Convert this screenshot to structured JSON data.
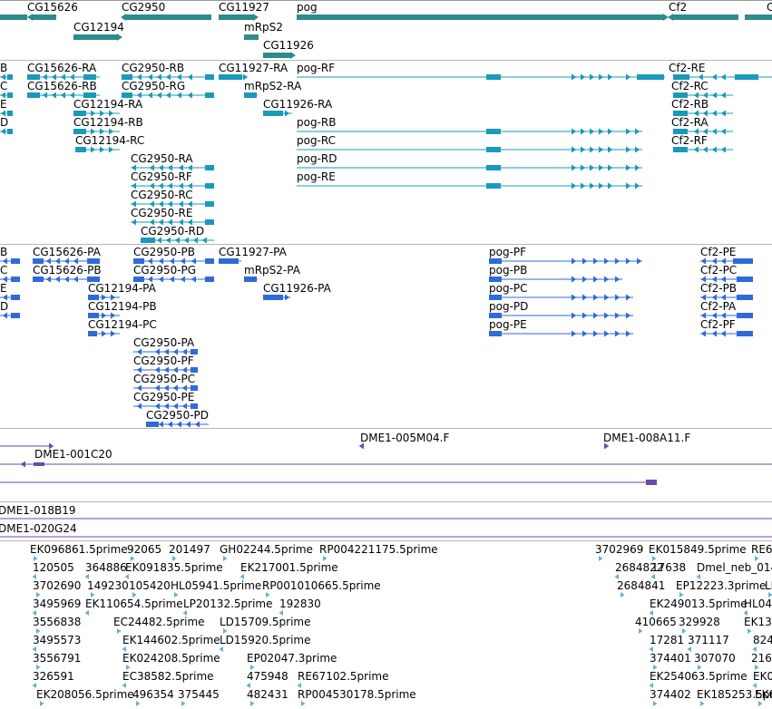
{
  "colors": {
    "gene": "#2e8b8b",
    "transcript": "#1a9ab8",
    "protein": "#2f6ad8",
    "clone": "#6a4aa8",
    "est": "#6aaed6",
    "separator": "#b8b8b8"
  },
  "tracks": {
    "genes": [
      {
        "label": "CG15626",
        "icon": "gene-arrow-left"
      },
      {
        "label": "CG2950",
        "icon": "gene-arrow-left"
      },
      {
        "label": "CG11927",
        "icon": "gene-arrow-right"
      },
      {
        "label": "pog",
        "icon": "gene-arrow-right"
      },
      {
        "label": "Cf2",
        "icon": "gene-arrow-left"
      },
      {
        "label": "C",
        "icon": "gene-arrow-left"
      },
      {
        "label": "CG12194",
        "icon": "gene-arrow-right"
      },
      {
        "label": "mRpS2",
        "icon": "gene-arrow-right"
      },
      {
        "label": "CG11926",
        "icon": "gene-arrow-right"
      }
    ],
    "transcripts": [
      {
        "label": "B"
      },
      {
        "label": "C"
      },
      {
        "label": "E"
      },
      {
        "label": "D"
      },
      {
        "label": "CG15626-RA"
      },
      {
        "label": "CG15626-RB"
      },
      {
        "label": "CG2950-RB"
      },
      {
        "label": "CG2950-RG"
      },
      {
        "label": "CG12194-RA"
      },
      {
        "label": "CG12194-RB"
      },
      {
        "label": "CG12194-RC"
      },
      {
        "label": "CG2950-RA"
      },
      {
        "label": "CG2950-RF"
      },
      {
        "label": "CG2950-RC"
      },
      {
        "label": "CG2950-RE"
      },
      {
        "label": "CG2950-RD"
      },
      {
        "label": "CG11927-RA"
      },
      {
        "label": "mRpS2-RA"
      },
      {
        "label": "CG11926-RA"
      },
      {
        "label": "pog-RF"
      },
      {
        "label": "pog-RB"
      },
      {
        "label": "pog-RC"
      },
      {
        "label": "pog-RD"
      },
      {
        "label": "pog-RE"
      },
      {
        "label": "Cf2-RE"
      },
      {
        "label": "Cf2-RC"
      },
      {
        "label": "Cf2-RB"
      },
      {
        "label": "Cf2-RA"
      },
      {
        "label": "Cf2-RF"
      }
    ],
    "proteins": [
      {
        "label": "B"
      },
      {
        "label": "C"
      },
      {
        "label": "E"
      },
      {
        "label": "D"
      },
      {
        "label": "CG15626-PA"
      },
      {
        "label": "CG15626-PB"
      },
      {
        "label": "CG2950-PB"
      },
      {
        "label": "CG2950-PG"
      },
      {
        "label": "CG12194-PA"
      },
      {
        "label": "CG12194-PB"
      },
      {
        "label": "CG12194-PC"
      },
      {
        "label": "CG2950-PA"
      },
      {
        "label": "CG2950-PF"
      },
      {
        "label": "CG2950-PC"
      },
      {
        "label": "CG2950-PE"
      },
      {
        "label": "CG2950-PD"
      },
      {
        "label": "CG11927-PA"
      },
      {
        "label": "mRpS2-PA"
      },
      {
        "label": "CG11926-PA"
      },
      {
        "label": "pog-PF"
      },
      {
        "label": "pog-PB"
      },
      {
        "label": "pog-PC"
      },
      {
        "label": "pog-PD"
      },
      {
        "label": "pog-PE"
      },
      {
        "label": "Cf2-PE"
      },
      {
        "label": "Cf2-PC"
      },
      {
        "label": "Cf2-PB"
      },
      {
        "label": "Cf2-PA"
      },
      {
        "label": "Cf2-PF"
      }
    ],
    "clones": [
      {
        "label": "DME1-005M04.F"
      },
      {
        "label": "DME1-008A11.F"
      },
      {
        "label": "DME1-001C20"
      }
    ],
    "clones2": [
      {
        "label": "DME1-018B19"
      },
      {
        "label": "DME1-020G24"
      }
    ],
    "ests": [
      {
        "label": "EK096861.5prime"
      },
      {
        "label": "92065"
      },
      {
        "label": "201497"
      },
      {
        "label": "GH02244.5prime"
      },
      {
        "label": "RP004221175.5prime"
      },
      {
        "label": "3702969"
      },
      {
        "label": "EK015849.5prime"
      },
      {
        "label": "RE6"
      },
      {
        "label": "120505"
      },
      {
        "label": "364886"
      },
      {
        "label": "EK091835.5prime"
      },
      {
        "label": "EK217001.5prime"
      },
      {
        "label": "2684822"
      },
      {
        "label": "17638"
      },
      {
        "label": "Dmel_neb_014"
      },
      {
        "label": "3702690"
      },
      {
        "label": "149230"
      },
      {
        "label": "105420"
      },
      {
        "label": "HL05941.5prime"
      },
      {
        "label": "RP001010665.5prime"
      },
      {
        "label": "2684841"
      },
      {
        "label": "EP12223.3prime"
      },
      {
        "label": "LI"
      },
      {
        "label": "3495969"
      },
      {
        "label": "EK110654.5prime"
      },
      {
        "label": "LP20132.5prime"
      },
      {
        "label": "192830"
      },
      {
        "label": "EK249013.5prime"
      },
      {
        "label": "HL04"
      },
      {
        "label": "3556838"
      },
      {
        "label": "EC24482.5prime"
      },
      {
        "label": "LD15709.5prime"
      },
      {
        "label": "410665"
      },
      {
        "label": "329928"
      },
      {
        "label": "EK13"
      },
      {
        "label": "3495573"
      },
      {
        "label": "EK144602.5prime"
      },
      {
        "label": "LD15920.5prime"
      },
      {
        "label": "17281"
      },
      {
        "label": "371117"
      },
      {
        "label": "824"
      },
      {
        "label": "3556791"
      },
      {
        "label": "EK024208.5prime"
      },
      {
        "label": "EP02047.3prime"
      },
      {
        "label": "374401"
      },
      {
        "label": "307070"
      },
      {
        "label": "216"
      },
      {
        "label": "326591"
      },
      {
        "label": "EC38582.5prime"
      },
      {
        "label": "475948"
      },
      {
        "label": "RE67102.5prime"
      },
      {
        "label": "EK254063.5prime"
      },
      {
        "label": "EK0"
      },
      {
        "label": "EK208056.5prime"
      },
      {
        "label": "496354"
      },
      {
        "label": "375445"
      },
      {
        "label": "482431"
      },
      {
        "label": "RP004530178.5prime"
      },
      {
        "label": "374402"
      },
      {
        "label": "EK185253.5prime"
      },
      {
        "label": "EK0"
      }
    ]
  }
}
